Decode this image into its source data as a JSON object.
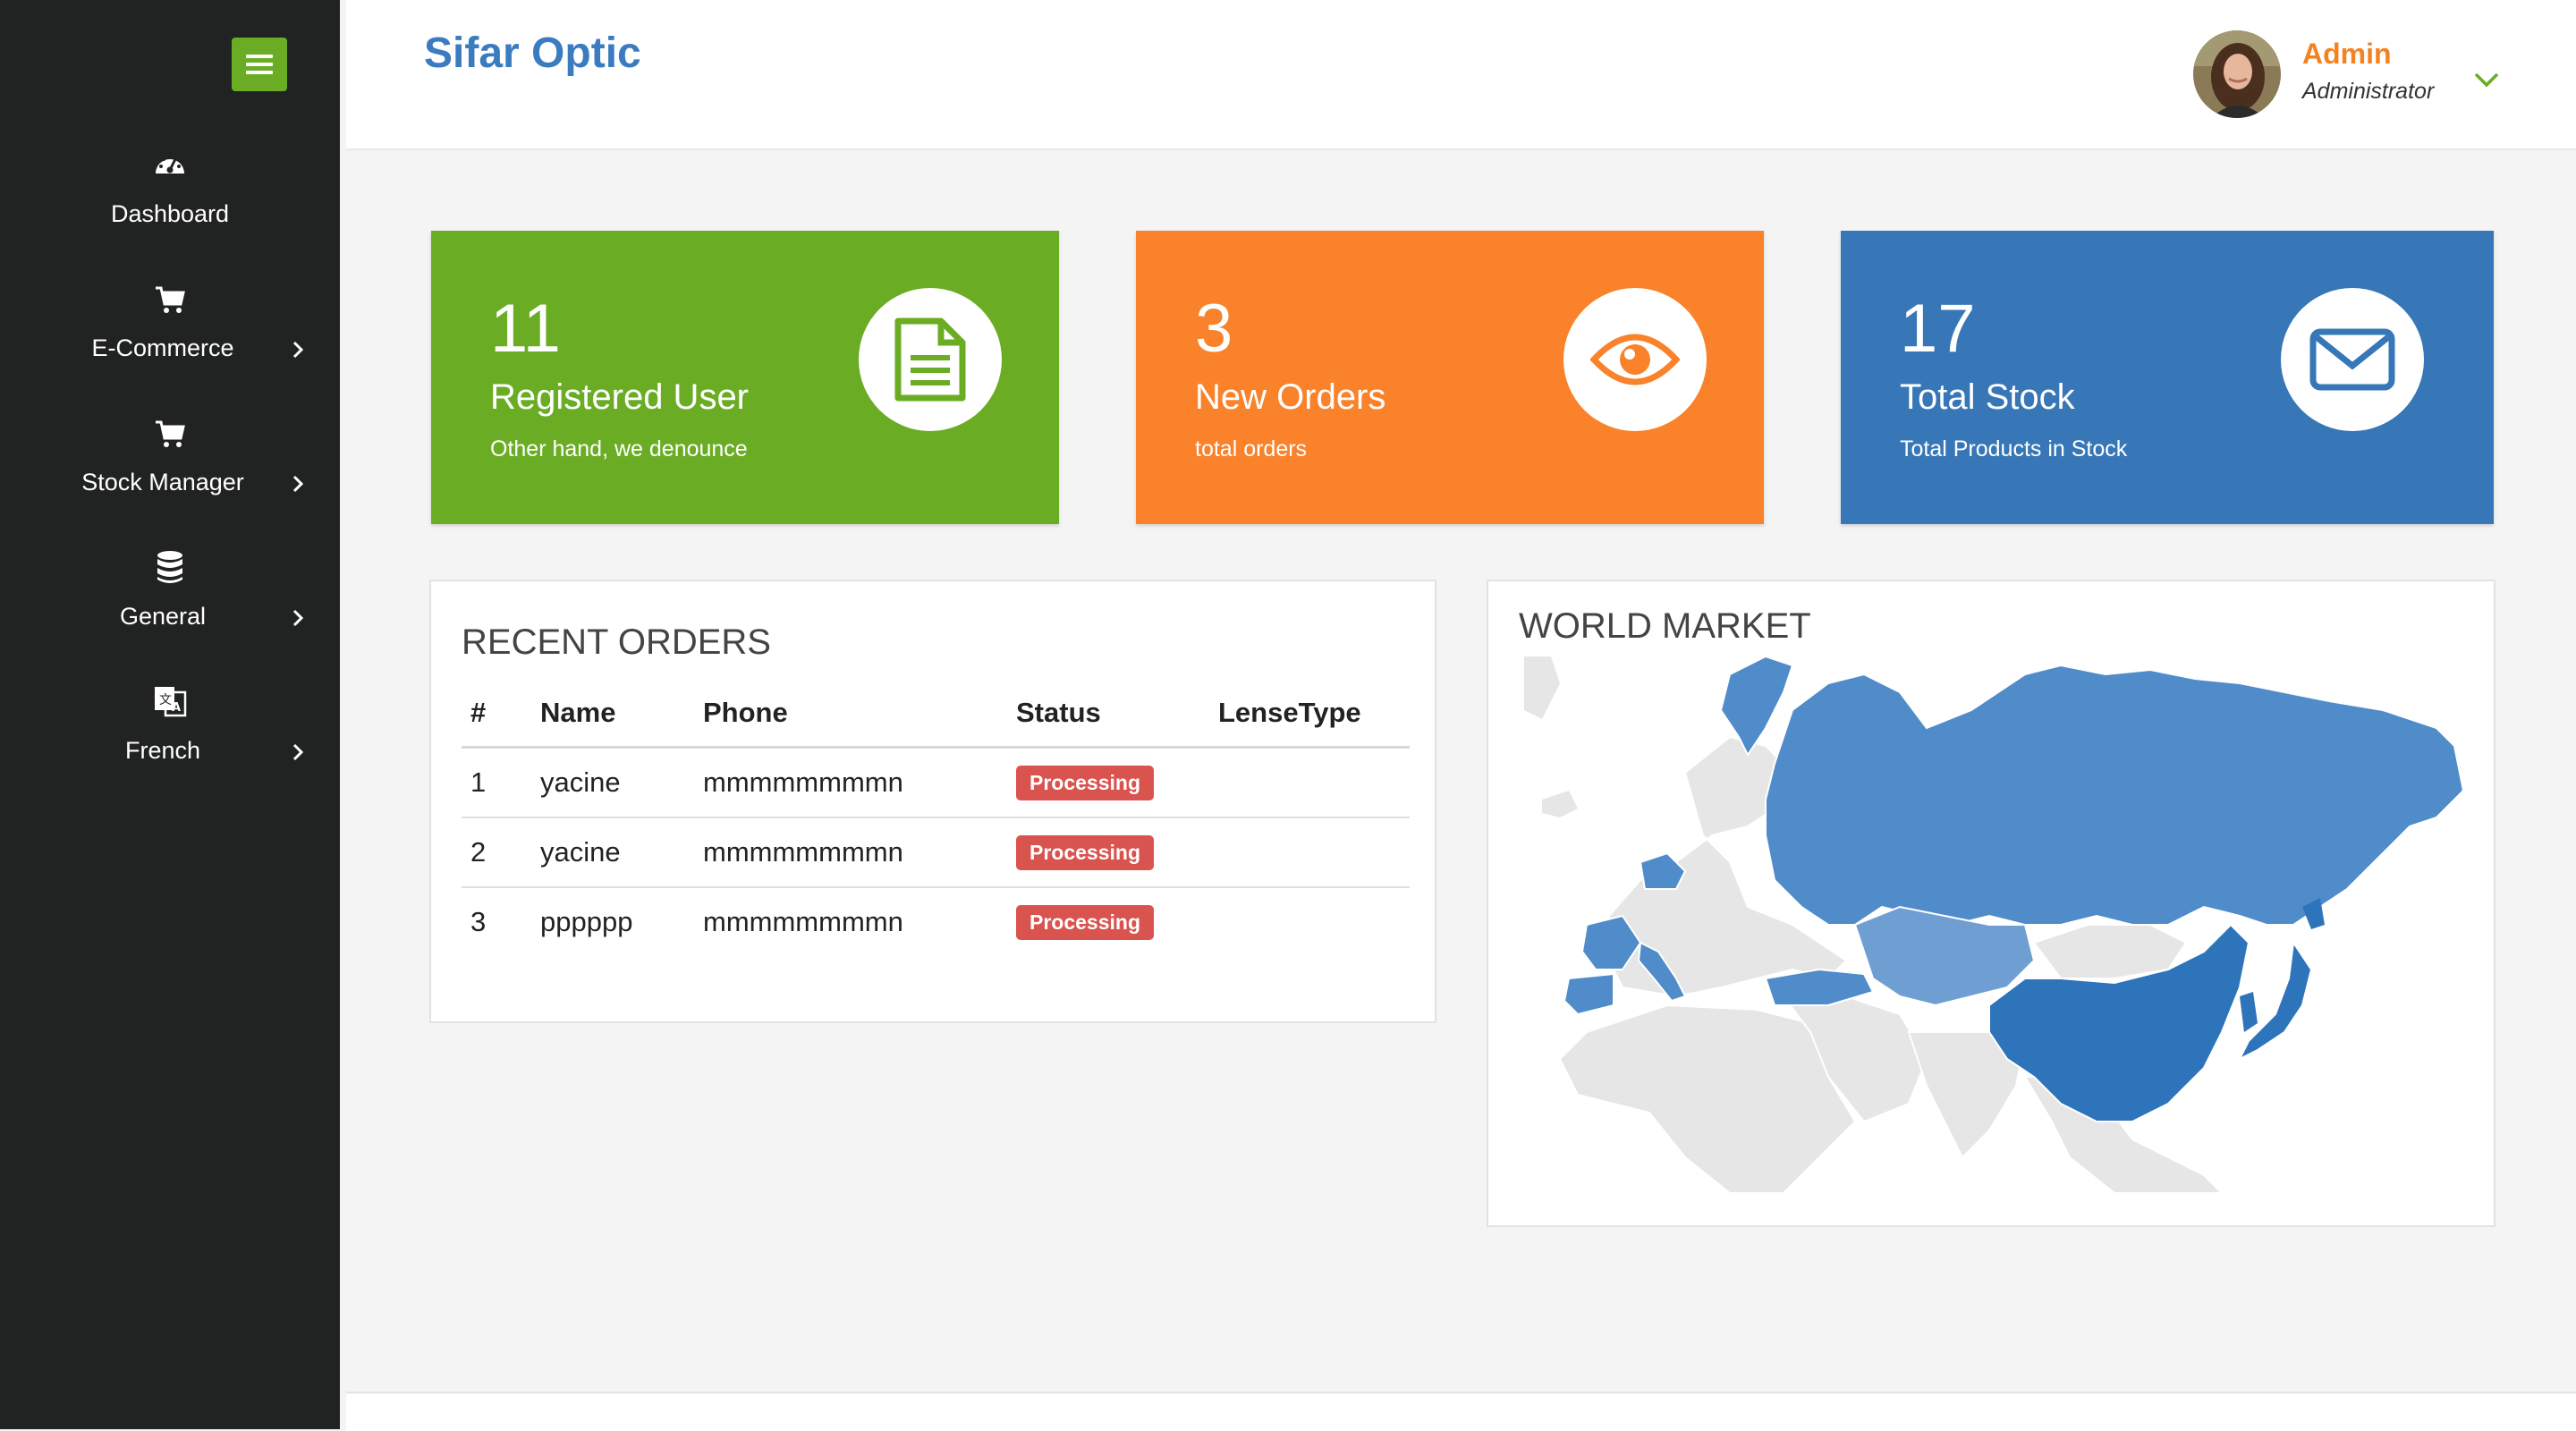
{
  "app": {
    "brand": "Sifar Optic"
  },
  "user": {
    "name": "Admin",
    "role": "Administrator"
  },
  "sidebar": {
    "items": [
      {
        "label": "Dashboard",
        "icon": "dashboard-icon"
      },
      {
        "label": "E-Commerce",
        "icon": "cart-icon"
      },
      {
        "label": "Stock Manager",
        "icon": "cart-icon"
      },
      {
        "label": "General",
        "icon": "database-icon"
      },
      {
        "label": "French",
        "icon": "translate-icon"
      }
    ]
  },
  "stats": [
    {
      "value": "11",
      "title": "Registered User",
      "subtitle": "Other hand, we denounce",
      "color": "#6aad24",
      "icon": "document-icon"
    },
    {
      "value": "3",
      "title": "New Orders",
      "subtitle": "total orders",
      "color": "#f9822b",
      "icon": "eye-icon"
    },
    {
      "value": "17",
      "title": "Total Stock",
      "subtitle": "Total Products in Stock",
      "color": "#3777b7",
      "icon": "envelope-icon"
    }
  ],
  "recent_orders": {
    "title": "RECENT ORDERS",
    "columns": [
      "#",
      "Name",
      "Phone",
      "Status",
      "LenseType"
    ],
    "rows": [
      {
        "id": "1",
        "name": "yacine",
        "phone": "mmmmmmmmn",
        "status": "Processing",
        "lense": ""
      },
      {
        "id": "2",
        "name": "yacine",
        "phone": "mmmmmmmmn",
        "status": "Processing",
        "lense": ""
      },
      {
        "id": "3",
        "name": "pppppp",
        "phone": "mmmmmmmmn",
        "status": "Processing",
        "lense": ""
      }
    ]
  },
  "world_market": {
    "title": "WORLD MARKET",
    "colors": {
      "land": "#e6e6e6",
      "highlight_dark": "#2e74bb",
      "highlight_mid": "#4f8cc9",
      "highlight_light": "#6f9fd2"
    }
  }
}
